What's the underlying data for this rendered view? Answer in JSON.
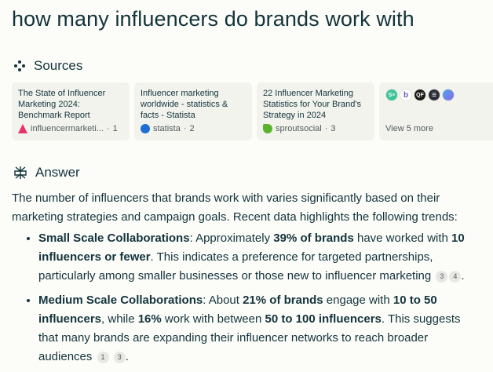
{
  "query": "how many influencers do brands work with",
  "sources_heading": "Sources",
  "answer_heading": "Answer",
  "sources": [
    {
      "title": "The State of Influencer Marketing 2024: Benchmark Report",
      "site": "influencermarketi...",
      "num": "1",
      "color": "#e8336a"
    },
    {
      "title": "Influencer marketing worldwide - statistics & facts - Statista",
      "site": "statista",
      "num": "2",
      "color": "#1d6fd1"
    },
    {
      "title": "22 Influencer Marketing Statistics for Your Brand's Strategy in 2024",
      "site": "sproutsocial",
      "num": "3",
      "color": "#59b32d"
    }
  ],
  "view_more": "View 5 more",
  "more_icons": [
    {
      "label": "S≡",
      "color": "#3cc39a"
    },
    {
      "label": "b",
      "color": "#6b5ab8"
    },
    {
      "label": "QF",
      "color": "#1a1a1a"
    },
    {
      "label": "≡",
      "color": "#2b2f3a"
    },
    {
      "label": "",
      "color": "#4aa3e8"
    }
  ],
  "answer": {
    "intro": "The number of influencers that brands work with varies significantly based on their marketing strategies and campaign goals. Recent data highlights the following trends:",
    "bullet1": {
      "heading": "Small Scale Collaborations",
      "t1": ": Approximately ",
      "b1": "39% of brands",
      "t2": " have worked with ",
      "b2": "10 influencers or fewer",
      "t3": ". This indicates a preference for targeted partnerships, particularly among smaller businesses or those new to influencer marketing",
      "cites": [
        "3",
        "4"
      ]
    },
    "bullet2": {
      "heading": "Medium Scale Collaborations",
      "t1": ": About ",
      "b1": "21% of brands",
      "t2": " engage with ",
      "b2": "10 to 50 influencers",
      "t3": ", while ",
      "b3": "16%",
      "t4": " work with between ",
      "b4": "50 to 100 influencers",
      "t5": ". This suggests that many brands are expanding their influencer networks to reach broader audiences",
      "cites": [
        "1",
        "3"
      ]
    }
  }
}
